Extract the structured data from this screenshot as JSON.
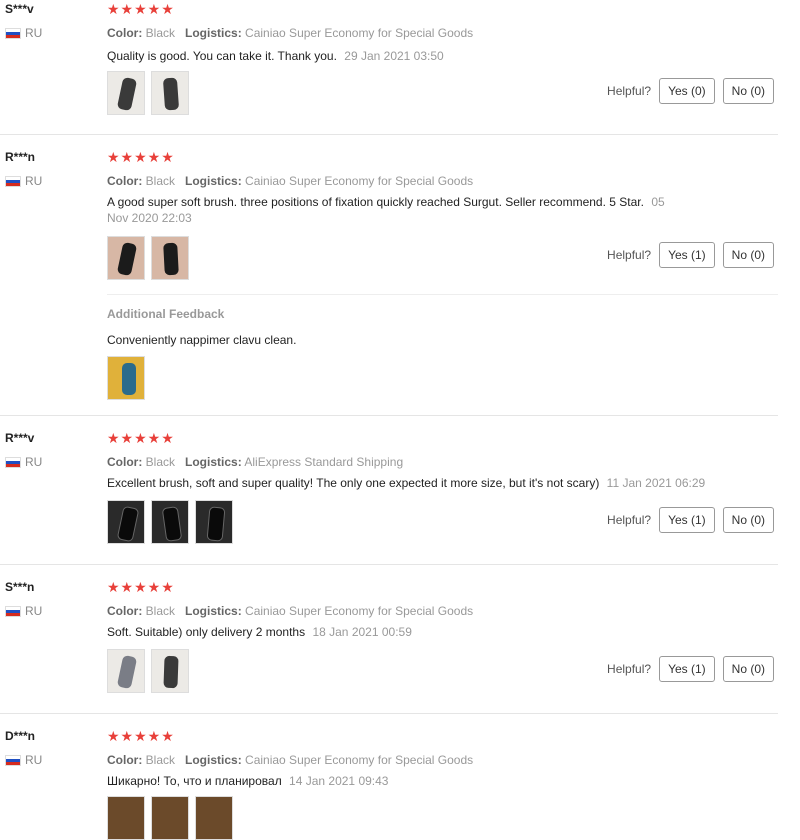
{
  "labels": {
    "color": "Color:",
    "logistics": "Logistics:",
    "helpful": "Helpful?",
    "additional_feedback": "Additional Feedback"
  },
  "reviews": [
    {
      "user": "S***v",
      "country": "RU",
      "stars": "★★★★★",
      "color": "Black",
      "logistics": "Cainiao Super Economy for Special Goods",
      "text": "Quality is good. You can take it. Thank you.",
      "date": "29 Jan 2021 03:50",
      "yes": "Yes (0)",
      "no": "No (0)"
    },
    {
      "user": "R***n",
      "country": "RU",
      "stars": "★★★★★",
      "color": "Black",
      "logistics": "Cainiao Super Economy for Special Goods",
      "text": "A good super soft brush. three positions of fixation quickly reached Surgut. Seller recommend. 5 Star.",
      "date": "05 Nov 2020 22:03",
      "yes": "Yes (1)",
      "no": "No (0)",
      "additional": "Conveniently nappimer clavu clean."
    },
    {
      "user": "R***v",
      "country": "RU",
      "stars": "★★★★★",
      "color": "Black",
      "logistics": "AliExpress Standard Shipping",
      "text": "Excellent brush, soft and super quality! The only one expected it more size, but it's not scary)",
      "date": "11 Jan 2021 06:29",
      "yes": "Yes (1)",
      "no": "No (0)"
    },
    {
      "user": "S***n",
      "country": "RU",
      "stars": "★★★★★",
      "color": "Black",
      "logistics": "Cainiao Super Economy for Special Goods",
      "text": "Soft. Suitable) only delivery 2 months",
      "date": "18 Jan 2021 00:59",
      "yes": "Yes (1)",
      "no": "No (0)"
    },
    {
      "user": "D***n",
      "country": "RU",
      "stars": "★★★★★",
      "color": "Black",
      "logistics": "Cainiao Super Economy for Special Goods",
      "text": "Шикарно! То, что и планировал",
      "date": "14 Jan 2021 09:43"
    }
  ]
}
